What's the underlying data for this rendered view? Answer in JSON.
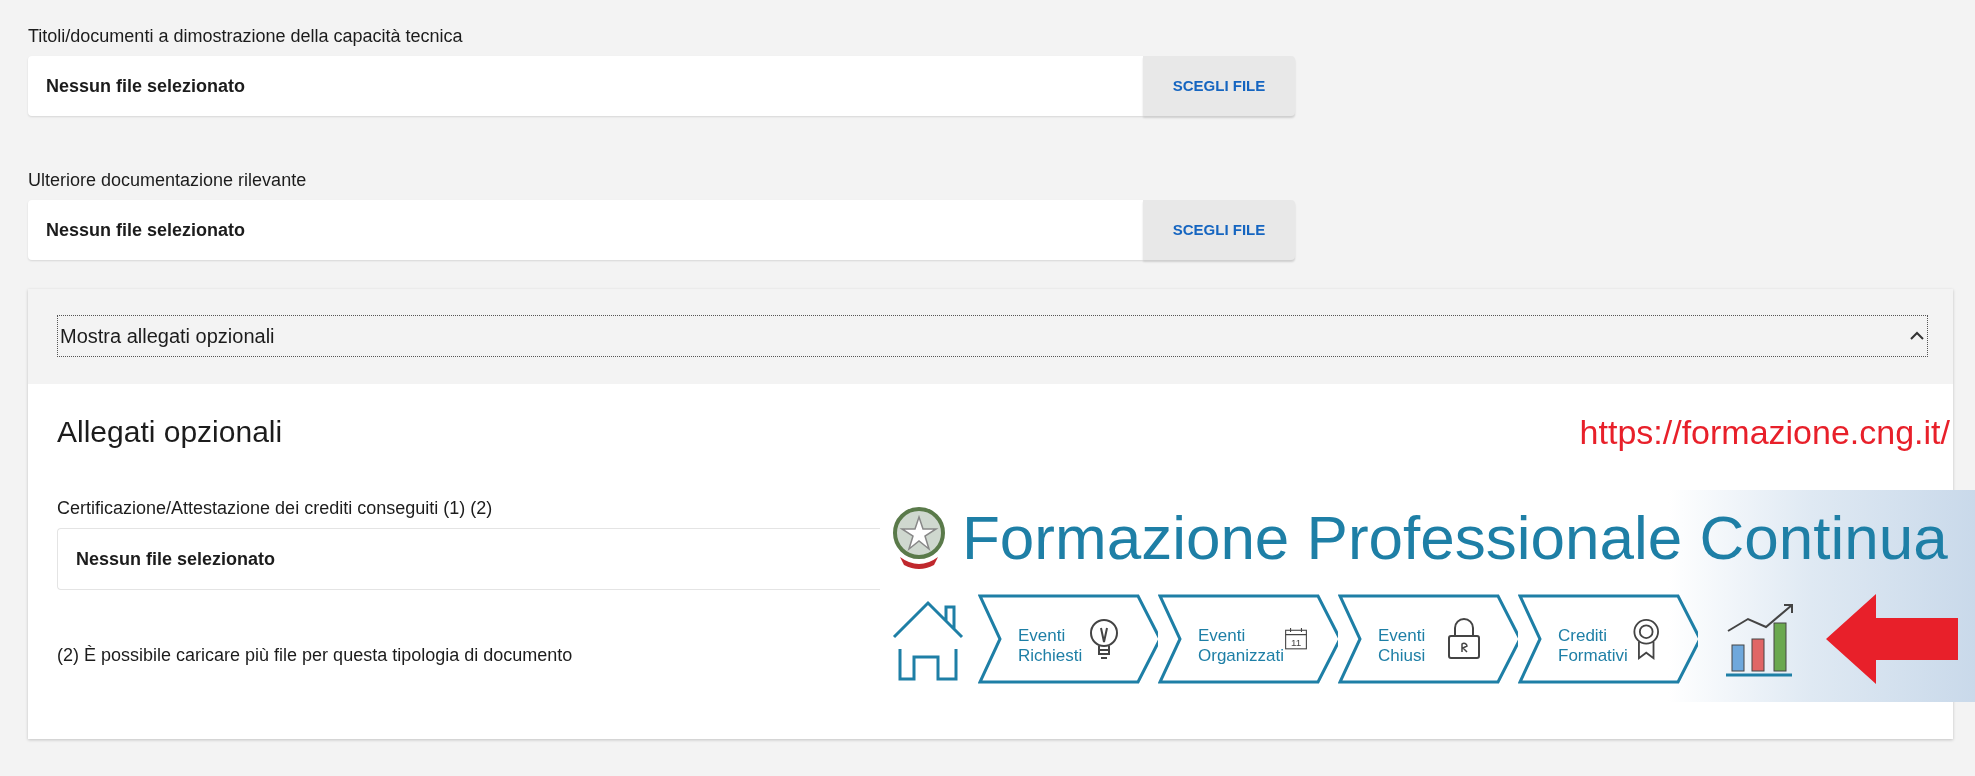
{
  "file_fields": [
    {
      "label": "Titoli/documenti a dimostrazione della capacità tecnica",
      "placeholder": "Nessun file selezionato",
      "button": "SCEGLI FILE"
    },
    {
      "label": "Ulteriore documentazione rilevante",
      "placeholder": "Nessun file selezionato",
      "button": "SCEGLI FILE"
    }
  ],
  "optional_section": {
    "toggle": "Mostra allegati opzionali",
    "expanded": true,
    "heading": "Allegati opzionali",
    "fields": [
      {
        "label": "Certificazione/Attestazione dei crediti conseguiti (1) (2)",
        "placeholder": "Nessun file selezionato"
      }
    ],
    "note": "(2) È possibile caricare più file per questa tipologia di documento"
  },
  "overlay": {
    "url": "https://formazione.cng.it/",
    "title": "Formazione Professionale Continua",
    "nav_items": [
      {
        "kind": "home"
      },
      {
        "kind": "bulb",
        "line1": "Eventi",
        "line2": "Richiesti"
      },
      {
        "kind": "calendar",
        "line1": "Eventi",
        "line2": "Organizzati",
        "icon_text": "11"
      },
      {
        "kind": "lock",
        "line1": "Eventi",
        "line2": "Chiusi"
      },
      {
        "kind": "medal",
        "line1": "Crediti",
        "line2": "Formativi"
      },
      {
        "kind": "chart"
      }
    ]
  }
}
